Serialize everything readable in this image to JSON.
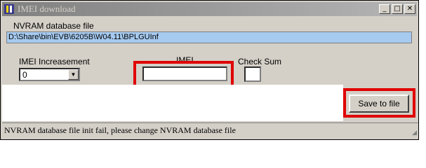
{
  "window": {
    "title": "IMEI download",
    "minimize_glyph": "_",
    "maximize_glyph": "□",
    "close_glyph": "✕"
  },
  "nvram": {
    "label": "NVRAM database file",
    "path": "D:\\Share\\bin\\EVB\\6205B\\W04.11\\BPLGUInf"
  },
  "imei_increasement": {
    "label": "IMEI Increasement",
    "selected": "0"
  },
  "imei": {
    "label": "IMEI",
    "value": ""
  },
  "checksum": {
    "label": "Check Sum",
    "value": ""
  },
  "save_button": {
    "label": "Save to file"
  },
  "status": {
    "text": "NVRAM database file init fail, please change NVRAM database file"
  },
  "colors": {
    "highlight": "#e00000",
    "path_bg": "#a6caf0",
    "titlebar": "#808080"
  }
}
